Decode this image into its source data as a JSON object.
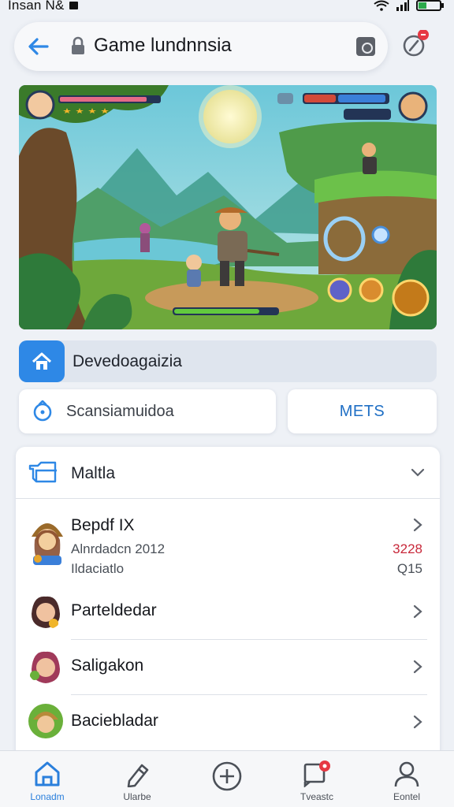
{
  "status_bar": {
    "left_text": "Insan N&"
  },
  "top_bar": {
    "title": "Game lundnnsia"
  },
  "section": {
    "label": "Devedoagaizia"
  },
  "search": {
    "placeholder": "Scansiamuidoa"
  },
  "action": {
    "label": "METS"
  },
  "list": {
    "title": "Maltla",
    "items": [
      {
        "name": "Bepdf IX",
        "sub1": "Alnrdadcn 2012",
        "sub2": "Ildaciatlo",
        "val1": "3228",
        "val2": "Q15",
        "val1_color": "#c8283a",
        "val2_color": "#4a5058"
      },
      {
        "name": "Parteldedar"
      },
      {
        "name": "Saligakon"
      },
      {
        "name": "Baciebladar"
      }
    ]
  },
  "bottom_nav": [
    {
      "label": "Lonadm",
      "icon": "home-icon"
    },
    {
      "label": "Ularbe",
      "icon": "pencil-icon"
    },
    {
      "label": "",
      "icon": "plus-circle-icon"
    },
    {
      "label": "Tveastc",
      "icon": "message-icon"
    },
    {
      "label": "Eontel",
      "icon": "profile-icon"
    }
  ],
  "colors": {
    "accent": "#2e88e6",
    "badge": "#e63843"
  }
}
